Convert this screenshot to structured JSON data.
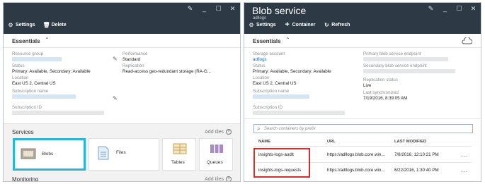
{
  "left": {
    "window_controls": [
      "pin-icon",
      "minimize-icon",
      "maximize-icon",
      "close-icon"
    ],
    "commands": [
      {
        "label": "Settings",
        "icon": "gear-icon"
      },
      {
        "label": "Delete",
        "icon": "trash-icon"
      }
    ],
    "essentials_label": "Essentials",
    "fields": {
      "resource_group_label": "Resource group",
      "status_label": "Status",
      "status_value": "Primary: Available, Secondary: Available",
      "location_label": "Location",
      "location_value": "East US 2, Central US",
      "subscription_name_label": "Subscription name",
      "subscription_id_label": "Subscription ID",
      "performance_label": "Performance",
      "performance_value": "Standard",
      "replication_label": "Replication",
      "replication_value": "Read-access geo-redundant storage (RA-G..."
    },
    "services_label": "Services",
    "monitoring_label": "Monitoring",
    "add_tiles_label": "Add tiles",
    "tiles": [
      {
        "label": "Blobs",
        "selected": true,
        "icon": "blob-icon"
      },
      {
        "label": "Files",
        "selected": false,
        "icon": "file-icon"
      },
      {
        "label": "Tables",
        "selected": false,
        "icon": "table-icon"
      },
      {
        "label": "Queues",
        "selected": false,
        "icon": "queue-icon"
      }
    ]
  },
  "right": {
    "title": "Blob service",
    "subtitle": "adllogs",
    "window_controls": [
      "pin-icon",
      "minimize-icon",
      "maximize-icon",
      "close-icon"
    ],
    "commands": [
      {
        "label": "Settings",
        "icon": "gear-icon"
      },
      {
        "label": "Container",
        "icon": "plus-icon"
      },
      {
        "label": "Refresh",
        "icon": "refresh-icon"
      }
    ],
    "essentials_label": "Essentials",
    "fields": {
      "storage_account_label": "Storage account",
      "storage_account_value": "adllogs",
      "primary_endpoint_label": "Primary blob service endpoint",
      "secondary_endpoint_label": "Secondary blob service endpoint",
      "replication_status_label": "Replication status",
      "replication_status_value": "Live",
      "last_synchronized_label": "Last synchronized",
      "last_synchronized_value": "7/19/2016, 8:39:05 AM",
      "status_label": "Status",
      "status_value": "Primary: Available, Secondary: Available",
      "location_label": "Location",
      "location_value": "East US 2, Central US",
      "subscription_name_label": "Subscription name",
      "subscription_id_label": "Subscription ID"
    },
    "search_placeholder": "Search containers by prefix",
    "table": {
      "headers": [
        "NAME",
        "URL",
        "LAST MODIFIED"
      ],
      "rows": [
        {
          "name": "insights-logs-audit",
          "url": "https://adllogs.blob.core.win...",
          "modified": "7/8/2016, 12:10:21 PM",
          "more": "..."
        },
        {
          "name": "insights-logs-requests",
          "url": "https://adllogs.blob.core.win...",
          "modified": "6/22/2016, 1:30:40 PM",
          "more": "..."
        }
      ]
    }
  }
}
